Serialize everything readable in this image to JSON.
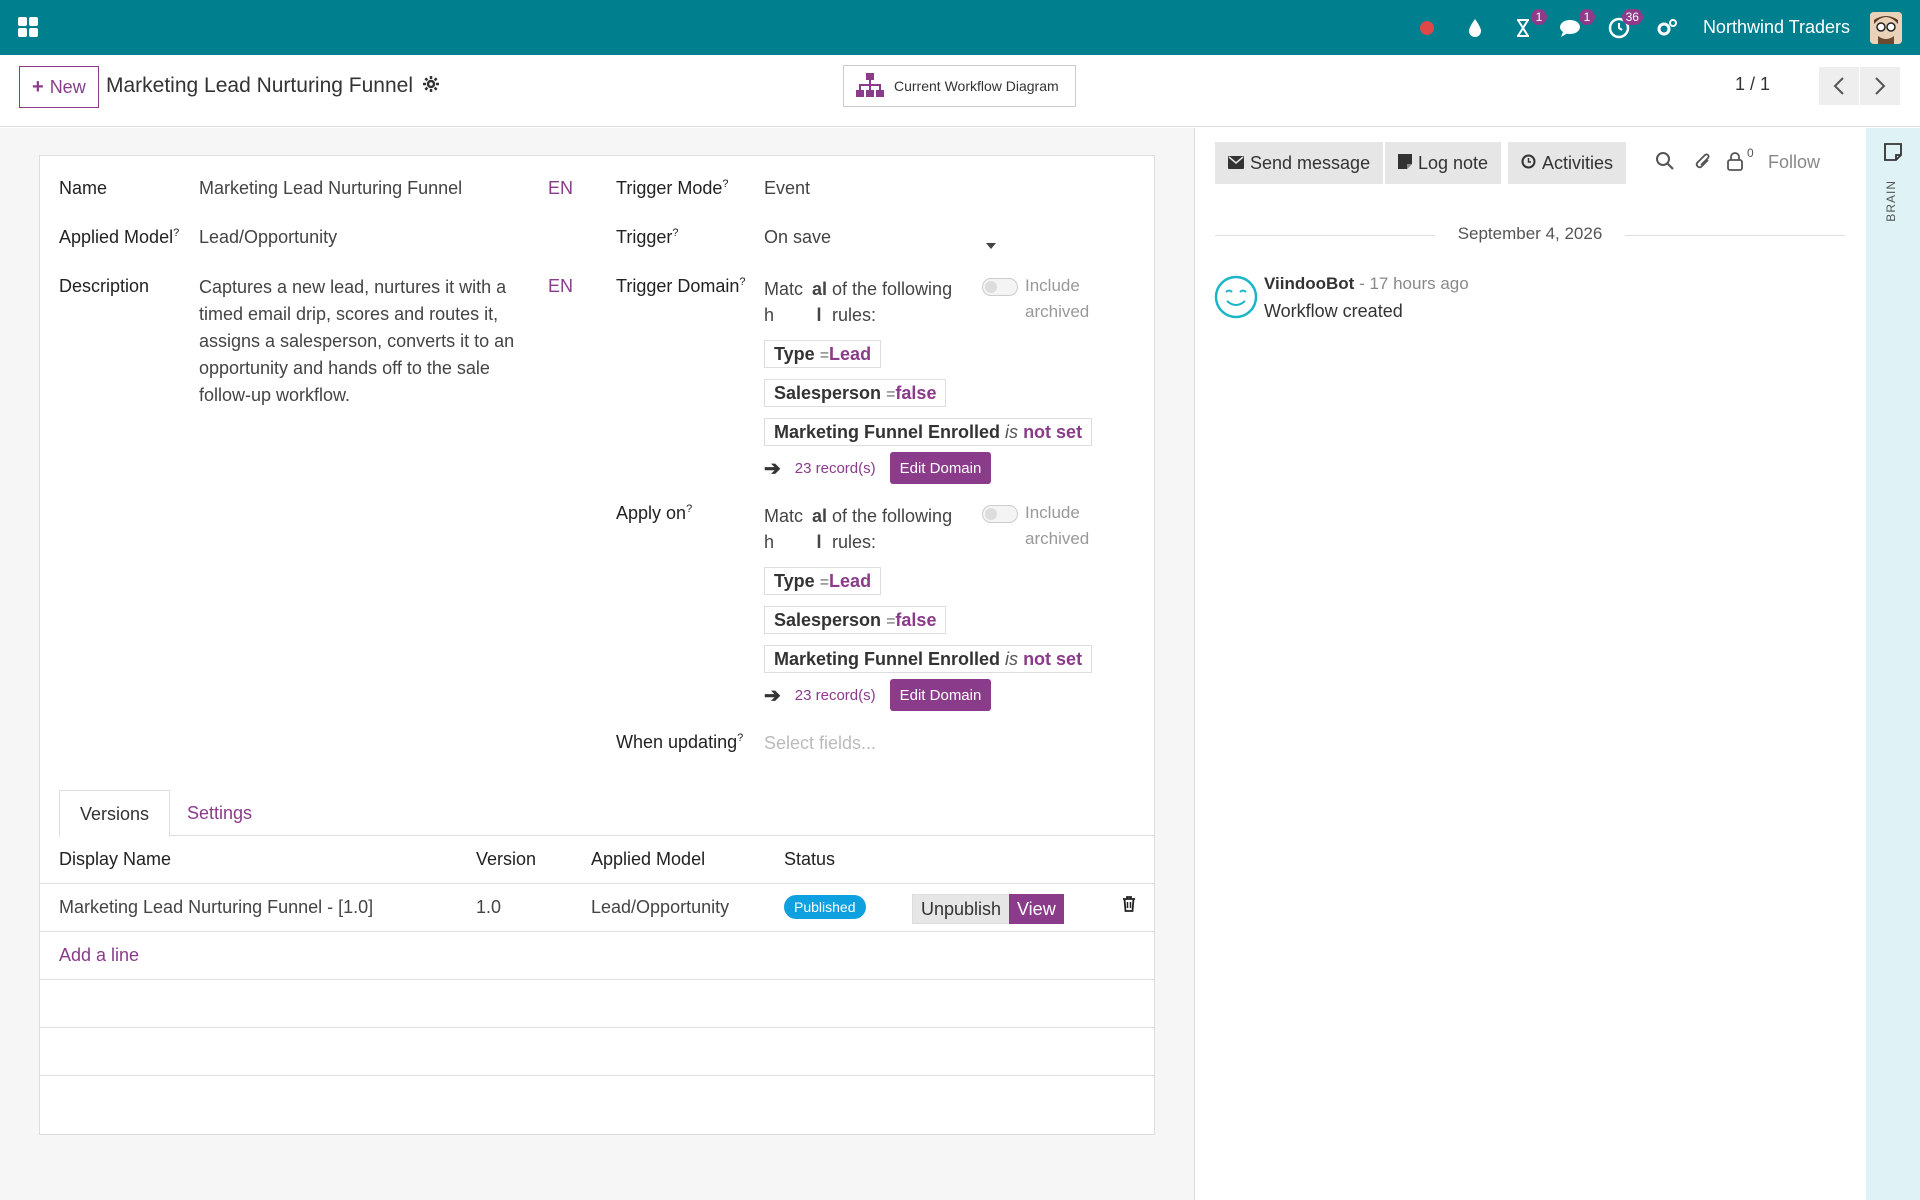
{
  "navbar": {
    "company": "Northwind Traders",
    "badges": {
      "activities": "1",
      "messages": "1",
      "timesheet": "36"
    },
    "accent": "#00808f"
  },
  "control_panel": {
    "new_label": "New",
    "title": "Marketing Lead Nurturing Funnel",
    "diagram_label": "Current Workflow Diagram",
    "pager": "1 / 1"
  },
  "form": {
    "name_label": "Name",
    "name_value": "Marketing Lead Nurturing Funnel",
    "lang": "EN",
    "model_label": "Applied Model",
    "model_value": "Lead/Opportunity",
    "desc_label": "Description",
    "desc_value": "Captures a new lead, nurtures it with a timed email drip, scores and routes it, assigns a salesperson, converts it to an opportunity and hands off to the sale follow-up workflow.",
    "trigger_mode_label": "Trigger Mode",
    "trigger_mode_value": "Event",
    "trigger_label": "Trigger",
    "trigger_value": "On save",
    "trigger_domain_label": "Trigger Domain",
    "apply_on_label": "Apply on",
    "when_updating_label": "When updating",
    "when_updating_placeholder": "Select fields...",
    "help_mark": "?",
    "domain": {
      "match_a": "Matc",
      "match_b": "h",
      "all_a": "al",
      "all_b": "l",
      "rule_text_a": "of the following",
      "rule_text_b": "rules:",
      "include_a": "Include",
      "include_b": "archived",
      "rule1_field": "Type",
      "rule1_op": "=",
      "rule1_value": "Lead",
      "rule2_field": "Salesperson",
      "rule2_op": "=",
      "rule2_value": "false",
      "rule3_field": "Marketing Funnel Enrolled",
      "rule3_op": "is",
      "rule3_value": "not set",
      "records": "23 record(s)",
      "edit_label": "Edit Domain"
    }
  },
  "tabs": {
    "versions": "Versions",
    "settings": "Settings"
  },
  "table": {
    "headers": {
      "display_name": "Display Name",
      "version": "Version",
      "model": "Applied Model",
      "status": "Status"
    },
    "row": {
      "display_name": "Marketing Lead Nurturing Funnel - [1.0]",
      "version": "1.0",
      "model": "Lead/Opportunity",
      "status": "Published",
      "unpublish": "Unpublish",
      "view": "View"
    },
    "add_line": "Add a line"
  },
  "chatter": {
    "send_message": "Send message",
    "log_note": "Log note",
    "activities": "Activities",
    "followers_count": "0",
    "follow": "Follow",
    "date": "September 4, 2026",
    "author": "ViindooBot",
    "time": "- 17 hours ago",
    "body": "Workflow created"
  },
  "side_panel": {
    "label": "BRAIN"
  }
}
